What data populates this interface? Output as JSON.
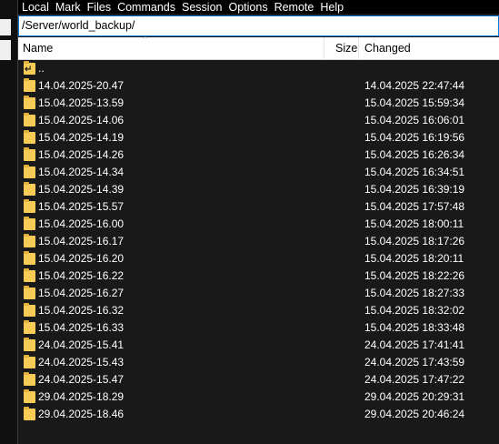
{
  "menu": [
    "Local",
    "Mark",
    "Files",
    "Commands",
    "Session",
    "Options",
    "Remote",
    "Help"
  ],
  "path": "/Server/world_backup/",
  "columns": {
    "name": "Name",
    "size": "Size",
    "changed": "Changed"
  },
  "parent_dir": "..",
  "rows": [
    {
      "name": "14.04.2025-20.47",
      "changed": "14.04.2025 22:47:44"
    },
    {
      "name": "15.04.2025-13.59",
      "changed": "15.04.2025 15:59:34"
    },
    {
      "name": "15.04.2025-14.06",
      "changed": "15.04.2025 16:06:01"
    },
    {
      "name": "15.04.2025-14.19",
      "changed": "15.04.2025 16:19:56"
    },
    {
      "name": "15.04.2025-14.26",
      "changed": "15.04.2025 16:26:34"
    },
    {
      "name": "15.04.2025-14.34",
      "changed": "15.04.2025 16:34:51"
    },
    {
      "name": "15.04.2025-14.39",
      "changed": "15.04.2025 16:39:19"
    },
    {
      "name": "15.04.2025-15.57",
      "changed": "15.04.2025 17:57:48"
    },
    {
      "name": "15.04.2025-16.00",
      "changed": "15.04.2025 18:00:11"
    },
    {
      "name": "15.04.2025-16.17",
      "changed": "15.04.2025 18:17:26"
    },
    {
      "name": "15.04.2025-16.20",
      "changed": "15.04.2025 18:20:11"
    },
    {
      "name": "15.04.2025-16.22",
      "changed": "15.04.2025 18:22:26"
    },
    {
      "name": "15.04.2025-16.27",
      "changed": "15.04.2025 18:27:33"
    },
    {
      "name": "15.04.2025-16.32",
      "changed": "15.04.2025 18:32:02"
    },
    {
      "name": "15.04.2025-16.33",
      "changed": "15.04.2025 18:33:48"
    },
    {
      "name": "24.04.2025-15.41",
      "changed": "24.04.2025 17:41:41"
    },
    {
      "name": "24.04.2025-15.43",
      "changed": "24.04.2025 17:43:59"
    },
    {
      "name": "24.04.2025-15.47",
      "changed": "24.04.2025 17:47:22"
    },
    {
      "name": "29.04.2025-18.29",
      "changed": "29.04.2025 20:29:31"
    },
    {
      "name": "29.04.2025-18.46",
      "changed": "29.04.2025 20:46:24"
    }
  ],
  "colors": {
    "folder": "#f6cc57",
    "list_bg": "#191919",
    "path_border": "#0078d7"
  }
}
